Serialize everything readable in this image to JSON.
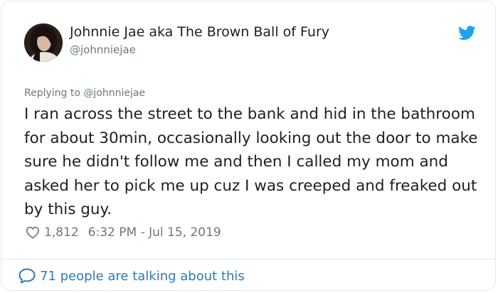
{
  "author": {
    "display_name": "Johnnie Jae aka The Brown Ball of Fury",
    "handle": "@johnniejae"
  },
  "reply": {
    "prefix": "Replying to",
    "mention": "@johnniejae"
  },
  "tweet": {
    "text": "I ran across the street to the bank and hid in the bathroom for about 30min, occasionally looking out the door to make sure he didn't follow me and then I called my mom and asked her to pick me up cuz I was creeped and freaked out by this guy.",
    "likes": "1,812",
    "timestamp": "6:32 PM - Jul 15, 2019"
  },
  "footer": {
    "talking_label": "71 people are talking about this"
  },
  "icons": {
    "brand": "twitter-bird-icon",
    "like": "heart-icon",
    "conversation": "speech-bubble-icon"
  },
  "colors": {
    "link_blue": "#2b7bb9",
    "twitter_blue": "#1da1f2",
    "muted_gray": "#697882",
    "text": "#1c2022"
  }
}
